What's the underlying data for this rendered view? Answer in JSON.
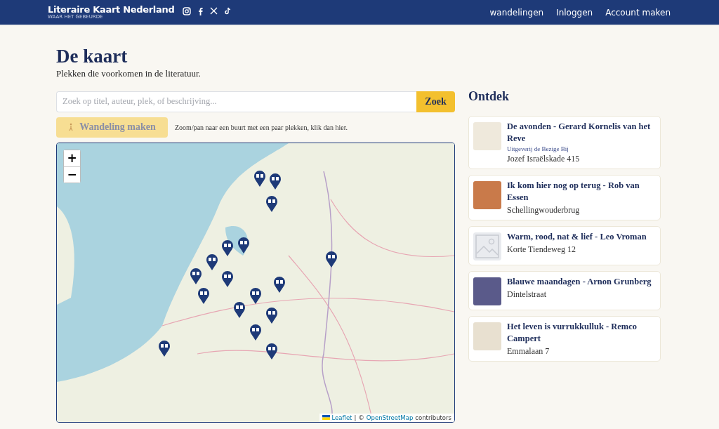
{
  "header": {
    "brand": "Literaire Kaart Nederland",
    "tagline": "WAAR HET GEBEURDE",
    "social": [
      {
        "kind": "instagram"
      },
      {
        "kind": "facebook"
      },
      {
        "kind": "x"
      },
      {
        "kind": "tiktok"
      }
    ],
    "nav": [
      "wandelingen",
      "Inloggen",
      "Account maken"
    ]
  },
  "page": {
    "title": "De kaart",
    "subtitle": "Plekken die voorkomen in de literatuur."
  },
  "search": {
    "placeholder": "Zoek op titel, auteur, plek, of beschrijving...",
    "button": "Zoek"
  },
  "walk": {
    "label": "Wandeling maken",
    "disabled": true,
    "hint": "Zoom/pan naar een buurt met een paar plekken, klik dan hier."
  },
  "map": {
    "zoom_in": "+",
    "zoom_out": "−",
    "attribution": {
      "library": "Leaflet",
      "separator": "|",
      "copyright": "©",
      "source": "OpenStreetMap",
      "suffix": "contributors"
    }
  },
  "discover": {
    "title": "Ontdek",
    "items": [
      {
        "title": "De avonden - Gerard Kornelis van het Reve",
        "publisher": "Uitgeverij de Bezige Bij",
        "place": "Jozef Israëlskade 415",
        "kind": "cover"
      },
      {
        "title": "Ik kom hier nog op terug - Rob van Essen",
        "place": "Schellingwouderbrug",
        "kind": "cover"
      },
      {
        "title": "Warm, rood, nat & lief - Leo Vroman",
        "place": "Korte Tiendeweg 12",
        "kind": "placeholder"
      },
      {
        "title": "Blauwe maandagen - Arnon Grunberg",
        "place": "Dintelstraat",
        "kind": "cover"
      },
      {
        "title": "Het leven is vurrukkulluk - Remco Campert",
        "place": "Emmalaan 7",
        "kind": "cover"
      }
    ]
  }
}
